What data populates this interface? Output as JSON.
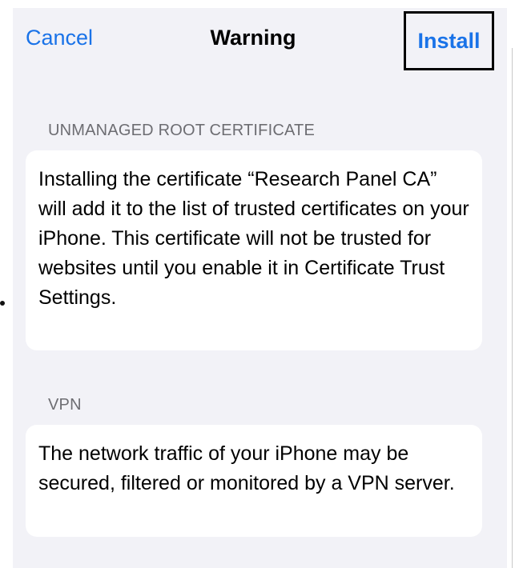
{
  "nav": {
    "cancel_label": "Cancel",
    "title": "Warning",
    "install_label": "Install"
  },
  "sections": [
    {
      "header": "UNMANAGED ROOT CERTIFICATE",
      "body": "Installing the certificate “Research Panel CA” will add it to the list of trusted certificates on your iPhone. This certificate will not be trusted for websites until you enable it in Certificate Trust Settings."
    },
    {
      "header": "VPN",
      "body": "The network traffic of your iPhone may be secured, filtered or monitored by a VPN server."
    }
  ],
  "colors": {
    "accent": "#1a73e8",
    "background": "#f2f2f7",
    "card": "#ffffff",
    "secondary_text": "#6d6d72"
  }
}
